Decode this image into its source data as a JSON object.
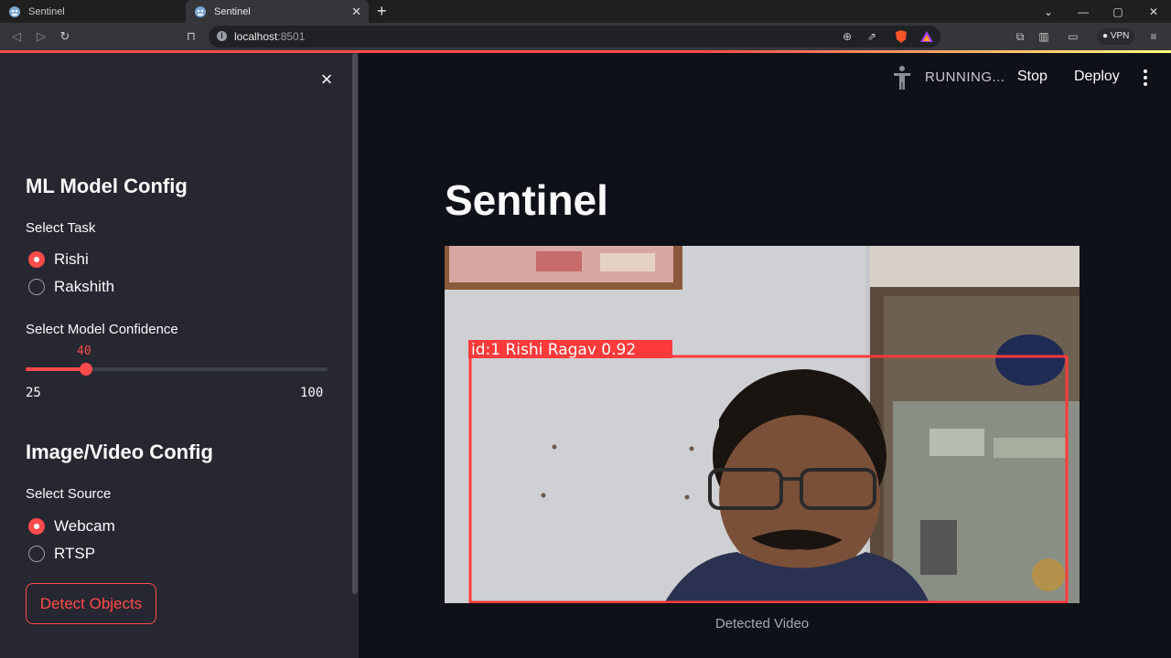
{
  "browser": {
    "tabs": [
      {
        "title": "Sentinel",
        "active": false
      },
      {
        "title": "Sentinel",
        "active": true
      }
    ],
    "url_host": "localhost",
    "url_port": ":8501",
    "vpn_label": "VPN"
  },
  "sidebar": {
    "close_icon": "×",
    "section_model": "ML Model Config",
    "task_label": "Select Task",
    "task_options": [
      {
        "label": "Rishi",
        "selected": true
      },
      {
        "label": "Rakshith",
        "selected": false
      }
    ],
    "confidence_label": "Select Model Confidence",
    "confidence": {
      "value": "40",
      "min": "25",
      "max": "100",
      "fraction": 0.2
    },
    "section_source": "Image/Video Config",
    "source_label": "Select Source",
    "source_options": [
      {
        "label": "Webcam",
        "selected": true
      },
      {
        "label": "RTSP",
        "selected": false
      }
    ],
    "detect_button": "Detect Objects"
  },
  "header": {
    "status": "RUNNING...",
    "stop": "Stop",
    "deploy": "Deploy"
  },
  "main": {
    "title": "Sentinel",
    "detection_label": "id:1 Rishi Ragav 0.92",
    "caption": "Detected Video"
  },
  "colors": {
    "accent": "#ff4b4b",
    "sidebar_bg": "#262730",
    "main_bg": "#0e1117"
  }
}
